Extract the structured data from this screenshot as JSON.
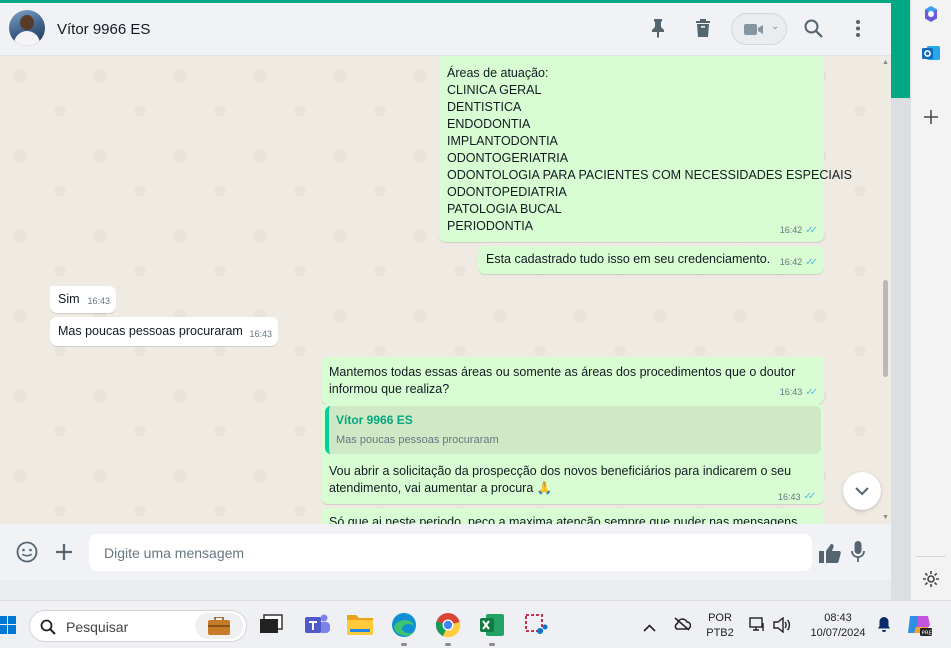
{
  "header": {
    "contact_name": "Vítor 9966 ES",
    "icons": [
      "pin-icon",
      "trash-icon",
      "video-call-icon",
      "search-icon",
      "more-menu-icon"
    ]
  },
  "messages": {
    "areas_lines": [
      "Áreas de atuação:",
      "CLINICA GERAL",
      "DENTISTICA",
      "ENDODONTIA",
      "IMPLANTODONTIA",
      "ODONTOGERIATRIA",
      "ODONTOLOGIA PARA PACIENTES COM NECESSIDADES ESPECIAIS",
      "ODONTOPEDIATRIA",
      "PATOLOGIA BUCAL",
      "PERIODONTIA"
    ],
    "areas_time": "16:42",
    "cadastro_text": "Esta cadastrado tudo isso em seu credenciamento.",
    "cadastro_time": "16:42",
    "sim_text": "Sim",
    "sim_time": "16:43",
    "poucas_text": "Mas poucas pessoas procuraram",
    "poucas_time": "16:43",
    "mantemos_line1": "Mantemos todas essas áreas ou somente as áreas dos procedimentos que o doutor",
    "mantemos_line2": "informou que realiza?",
    "mantemos_time": "16:43",
    "quote_name": "Vítor 9966 ES",
    "quote_text": "Mas poucas pessoas procuraram",
    "abrir_line1": "Vou abrir a solicitação da prospecção dos novos beneficiários para indicarem o seu",
    "abrir_line2": "atendimento, vai aumentar a procura 🙏",
    "abrir_time": "16:43",
    "last_partial": "Só que ai neste periodo, peço a maxima atenção sempre que puder nas mensagens,"
  },
  "composer": {
    "placeholder": "Digite uma mensagem",
    "icons": [
      "emoji-icon",
      "plus-icon",
      "thumbs-up-icon",
      "microphone-icon"
    ]
  },
  "taskbar": {
    "search_placeholder": "Pesquisar",
    "lang_line1": "POR",
    "lang_line2": "PTB2",
    "clock_time": "08:43",
    "clock_date": "10/07/2024"
  },
  "colors": {
    "accent": "#00a884",
    "outgoing_bubble": "#d9fdd3",
    "incoming_bubble": "#ffffff",
    "chat_background": "#efeae2",
    "read_ticks": "#53bdeb"
  }
}
